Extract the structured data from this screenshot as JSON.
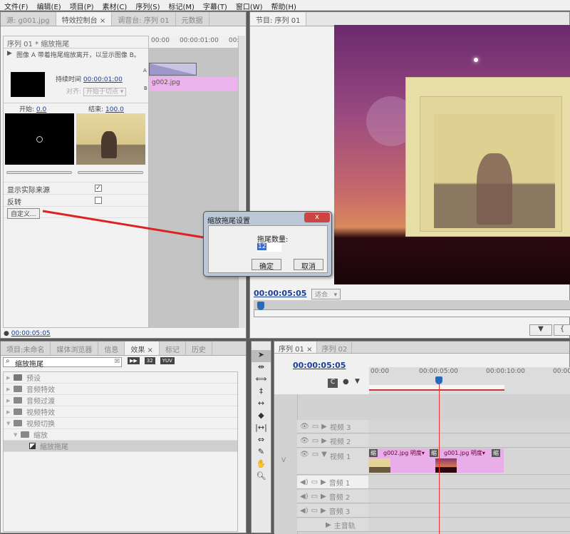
{
  "menu": [
    "文件(F)",
    "编辑(E)",
    "项目(P)",
    "素材(C)",
    "序列(S)",
    "标记(M)",
    "字幕(T)",
    "窗口(W)",
    "帮助(H)"
  ],
  "top_left": {
    "tabs": [
      "源: g001.jpg",
      "特效控制台 ×",
      "调音台: 序列 01",
      "元数据"
    ],
    "header": "序列 01 * 缩放拖尾",
    "description": "图像 A 带着拖尾缩放离开，以显示图像 B。",
    "duration_label": "持续时间",
    "duration": "00:00:01:00",
    "align_label": "对齐:",
    "align_value": "开始于切点",
    "start_label": "开始:",
    "start_value": "0.0",
    "end_label": "结束:",
    "end_value": "100.0",
    "show_source": "显示实际来源",
    "reverse": "反转",
    "custom_button": "自定义...",
    "ruler": [
      "00:00",
      "00:00:01:00",
      "00:0"
    ],
    "clip": "g002.jpg",
    "label_a": "A",
    "label_b": "B",
    "timecode": "00:00:05:05"
  },
  "program": {
    "tab": "节目: 序列 01",
    "timecode": "00:00:05:05",
    "fit": "适合"
  },
  "dialog": {
    "title": "缩放拖尾设置",
    "field_label": "拖尾数量:",
    "field_value": "12",
    "ok": "确定",
    "cancel": "取消",
    "close": "x"
  },
  "effects": {
    "tabs": [
      "项目:未命名",
      "媒体浏览器",
      "信息",
      "效果 ×",
      "标记",
      "历史"
    ],
    "search": "缩放拖尾",
    "badges": [
      "32",
      "YUV"
    ],
    "tree": [
      {
        "label": "预设",
        "depth": 0,
        "open": false
      },
      {
        "label": "音频特效",
        "depth": 0,
        "open": false
      },
      {
        "label": "音频过渡",
        "depth": 0,
        "open": false
      },
      {
        "label": "视频特效",
        "depth": 0,
        "open": false
      },
      {
        "label": "视频切换",
        "depth": 0,
        "open": true
      },
      {
        "label": "缩放",
        "depth": 1,
        "open": true
      },
      {
        "label": "缩放拖尾",
        "depth": 2,
        "selected": true
      }
    ]
  },
  "timeline": {
    "tabs": [
      "序列 01 ×",
      "序列 02"
    ],
    "timecode": "00:00:05:05",
    "ruler": [
      "00:00",
      "00:00:05:00",
      "00:00:10:00",
      "00:00"
    ],
    "tracks": [
      "视频 3",
      "视频 2",
      "视频 1",
      "音频 1",
      "音频 2",
      "音频 3",
      "主音轨"
    ],
    "v_label": "V",
    "clips": [
      {
        "name": "g002.jpg",
        "fx": "明度"
      },
      {
        "name": "g001.jpg",
        "fx": "明度"
      }
    ],
    "transition": "缩"
  }
}
